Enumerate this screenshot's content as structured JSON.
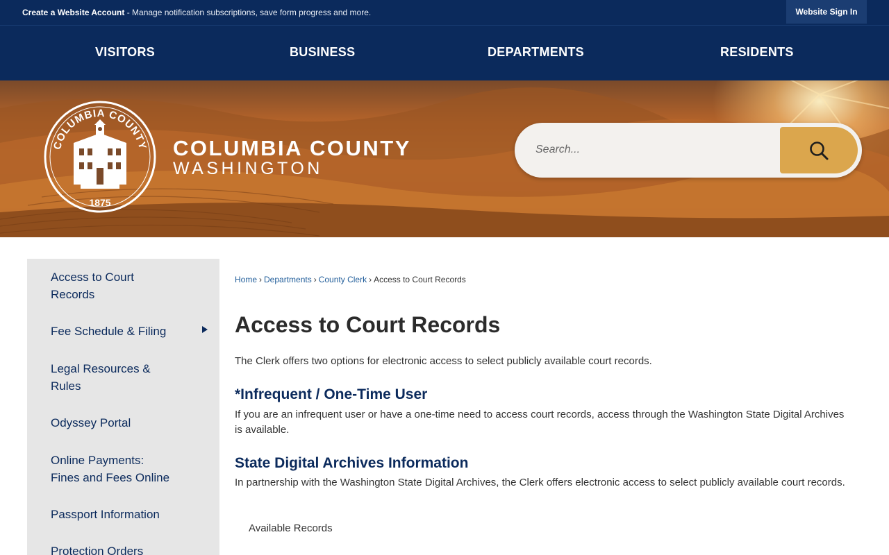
{
  "topbar": {
    "promo_bold": "Create a Website Account",
    "promo_text": " - Manage notification subscriptions, save form progress and more.",
    "signin_label": "Website Sign In"
  },
  "nav": {
    "items": [
      {
        "label": "VISITORS"
      },
      {
        "label": "BUSINESS"
      },
      {
        "label": "DEPARTMENTS"
      },
      {
        "label": "RESIDENTS"
      }
    ]
  },
  "header": {
    "seal_text_top": "COLUMBIA COUNTY",
    "seal_year": "1875",
    "county_name": "COLUMBIA COUNTY",
    "county_state": "WASHINGTON"
  },
  "search": {
    "placeholder": "Search...",
    "icon": "search-icon"
  },
  "sidebar": {
    "items": [
      {
        "line1": "Access to Court",
        "line2": "Records"
      },
      {
        "line1": "Fee Schedule & Filing",
        "line2": ""
      },
      {
        "line1": "Legal Resources &",
        "line2": "Rules"
      },
      {
        "line1": "Odyssey Portal",
        "line2": ""
      },
      {
        "line1": "Online Payments:",
        "line2": "Fines and Fees Online"
      },
      {
        "line1": "Passport Information",
        "line2": ""
      },
      {
        "line1": "Protection Orders",
        "line2": ""
      }
    ]
  },
  "breadcrumb": {
    "home": "Home",
    "departments": "Departments",
    "county_clerk": "County Clerk",
    "current": "Access to Court Records",
    "separator": "›"
  },
  "content": {
    "title": "Access to Court Records",
    "intro": "The Clerk offers two options for electronic access to select publicly available court records.",
    "section1_heading": "*Infrequent / One-Time User",
    "section1_text": "If you are an infrequent user or have a one-time need to access court records, access through the Washington State Digital Archives is available.",
    "section2_heading": "State Digital Archives Information",
    "section2_text": "In partnership with the Washington State Digital Archives, the Clerk offers electronic access to select publicly available court records.",
    "available_records": "Available Records"
  },
  "colors": {
    "navy": "#0b2a5c",
    "accent_gold": "#dba64d",
    "link_blue": "#1f5c99",
    "sidebar_bg": "#e6e6e6"
  }
}
